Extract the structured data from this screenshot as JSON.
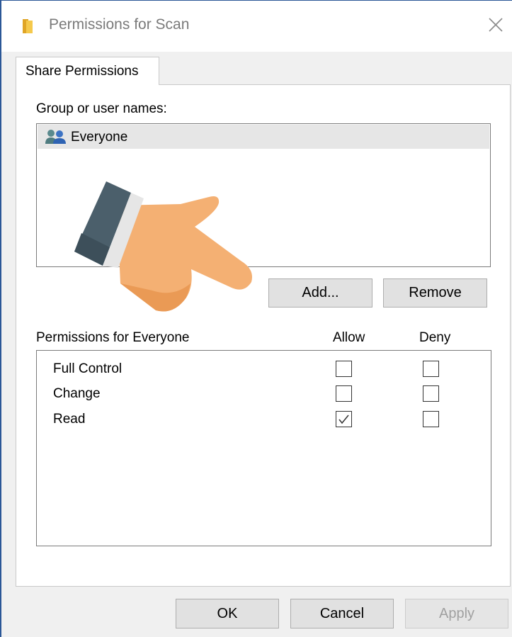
{
  "window": {
    "title": "Permissions for Scan",
    "icon": "folder-icon",
    "close_icon": "close-icon"
  },
  "tabs": [
    {
      "label": "Share Permissions",
      "active": true
    }
  ],
  "group_section": {
    "label": "Group or user names:",
    "items": [
      {
        "name": "Everyone",
        "icon": "users-icon",
        "selected": true
      }
    ],
    "add_button": "Add...",
    "remove_button": "Remove"
  },
  "permissions": {
    "header": "Permissions for Everyone",
    "allow_header": "Allow",
    "deny_header": "Deny",
    "rows": [
      {
        "name": "Full Control",
        "allow": false,
        "deny": false
      },
      {
        "name": "Change",
        "allow": false,
        "deny": false
      },
      {
        "name": "Read",
        "allow": true,
        "deny": false
      }
    ]
  },
  "footer": {
    "ok": "OK",
    "cancel": "Cancel",
    "apply": "Apply",
    "apply_disabled": true
  },
  "overlay": {
    "icon": "pointing-hand-icon"
  },
  "colors": {
    "dialog_bg": "#f0f0f0",
    "panel_bg": "#ffffff",
    "selection": "#e6e6e6",
    "button_bg": "#e1e1e1",
    "hand_skin": "#f4b073",
    "hand_cuff": "#4b5f6b"
  }
}
